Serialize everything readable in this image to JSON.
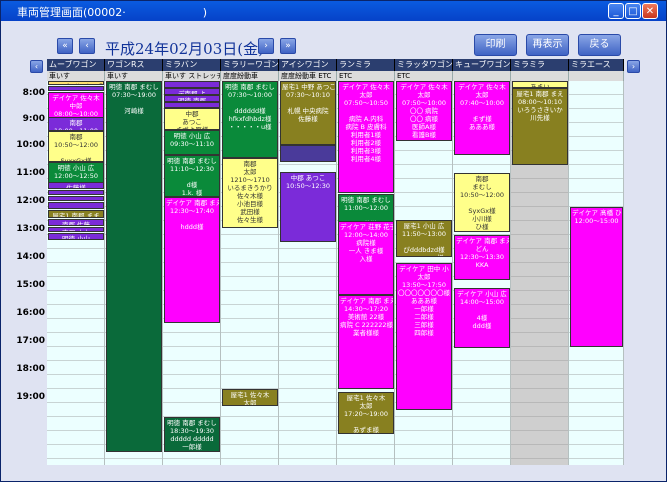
{
  "window": {
    "title": "車両管理画面(00002·                      )"
  },
  "nav": {
    "first": "«",
    "prev": "‹",
    "next": "›",
    "last": "»"
  },
  "date_label": "平成24年02月03日(金)",
  "actions": {
    "print": "印刷",
    "refresh": "再表示",
    "back": "戻る"
  },
  "columns": [
    {
      "name": "ムーブワゴン",
      "sub": "車いす"
    },
    {
      "name": "ワゴンRス",
      "sub": "車いす"
    },
    {
      "name": "ミラバン",
      "sub": "車いす ストレッチ"
    },
    {
      "name": "ミラリーワゴン",
      "sub": "度度紛動車"
    },
    {
      "name": "アイシワゴン",
      "sub": "度度紛動車 ETC"
    },
    {
      "name": "ランミラ",
      "sub": "ETC"
    },
    {
      "name": "ミラッタワゴン",
      "sub": "ETC"
    },
    {
      "name": "キューブワゴン",
      "sub": ""
    },
    {
      "name": "ミラミラ",
      "sub": ""
    },
    {
      "name": "ミラエース",
      "sub": ""
    }
  ],
  "times": [
    "8:00",
    "9:00",
    "10:00",
    "11:00",
    "12:00",
    "13:00",
    "14:00",
    "15:00",
    "16:00",
    "17:00",
    "18:00",
    "19:00"
  ],
  "bookings": [
    {
      "col": 0,
      "row": 0,
      "span": 0.3,
      "color": "#ffe070",
      "text": "ムーブ・瀬(中・〇〇"
    },
    {
      "col": 0,
      "row": 0.35,
      "span": 0.35,
      "color": "#7b2bd9",
      "text": ""
    },
    {
      "col": 0,
      "row": 0.75,
      "span": 2.6,
      "color": "#ff00ff",
      "text": "デイケア 佐々木\n中郎\n08:00〜10:00\nまず香様"
    },
    {
      "col": 0,
      "row": 2.6,
      "span": 1.0,
      "color": "#7b2bd9",
      "text": "南郡\n10:00〜11:00"
    },
    {
      "col": 0,
      "row": 3.6,
      "span": 2.2,
      "color": "#ffff8a",
      "text": "南郡\n10:50〜12:00\n\nSyxxGx様\n小川様\nひふVhn様"
    },
    {
      "col": 0,
      "row": 5.8,
      "span": 1.5,
      "color": "#0a8a3a",
      "text": "明徳 小山 広\n12:00〜12:50"
    },
    {
      "col": 0,
      "row": 7.2,
      "span": 0.5,
      "color": "#7b2bd9",
      "text": "佐藤様"
    },
    {
      "col": 0,
      "row": 7.75,
      "span": 0.4,
      "color": "#7b2bd9",
      "text": ""
    },
    {
      "col": 0,
      "row": 8.2,
      "span": 0.4,
      "color": "#7b2bd9",
      "text": ""
    },
    {
      "col": 0,
      "row": 8.65,
      "span": 0.5,
      "color": "#7b2bd9",
      "text": ""
    },
    {
      "col": 0,
      "row": 9.2,
      "span": 0.6,
      "color": "#888020",
      "text": "屋宅1 南郡 まま"
    },
    {
      "col": 0,
      "row": 9.85,
      "span": 0.5,
      "color": "#7b2bd9",
      "text": "南郡 佐藤"
    },
    {
      "col": 0,
      "row": 10.4,
      "span": 0.4,
      "color": "#7b2bd9",
      "text": "南郡 小山"
    },
    {
      "col": 0,
      "row": 10.85,
      "span": 0.5,
      "color": "#7b2bd9",
      "text": "明徳 小山"
    },
    {
      "col": 1,
      "row": 0,
      "span": 26.5,
      "color": "#0a6a3a",
      "text": "明徳 南郡 まむし\n07:30〜19:00\n\n河崎様"
    },
    {
      "col": 2,
      "row": 0,
      "span": 0.5,
      "color": "#7b2bd9",
      "text": ""
    },
    {
      "col": 2,
      "row": 0.5,
      "span": 0.5,
      "color": "#7b2bd9",
      "text": "デ南郡 よ"
    },
    {
      "col": 2,
      "row": 1.0,
      "span": 0.5,
      "color": "#7b2bd9",
      "text": "明徳 南郡"
    },
    {
      "col": 2,
      "row": 1.5,
      "span": 0.4,
      "color": "#7b2bd9",
      "text": ""
    },
    {
      "col": 2,
      "row": 1.9,
      "span": 1.6,
      "color": "#ffff8a",
      "text": "中郡\nあつこ\nまずよ原様"
    },
    {
      "col": 2,
      "row": 3.5,
      "span": 1.8,
      "color": "#0a8a3a",
      "text": "明徳 小山 広\n09:30〜11:10\n\nddddd様"
    },
    {
      "col": 2,
      "row": 5.3,
      "span": 3.0,
      "color": "#0a8a3a",
      "text": "明徳 南郡 まむし\n11:10〜12:30\n\nd様\n1.k. 様\nz様 様"
    },
    {
      "col": 2,
      "row": 8.3,
      "span": 9.0,
      "color": "#ff00ff",
      "text": "デイケア 南郡 まえ\n12:30〜17:40\n\nhddd様"
    },
    {
      "col": 2,
      "row": 24.0,
      "span": 2.5,
      "color": "#0a6a3a",
      "text": "明徳 南郡 まむし\n18:30〜19:30\nddddd ddddd\n一郎様"
    },
    {
      "col": 3,
      "row": 0,
      "span": 5.5,
      "color": "#0a8a3a",
      "text": "明徳 南郡 まむし\n07:30〜10:00\n\ndddddd様\nhfkxfdhbdz様\n・・・・・u様"
    },
    {
      "col": 3,
      "row": 5.5,
      "span": 5.0,
      "color": "#ffff8a",
      "text": "南郡\n太郎\n1210〜1710\nいるまきうかり\n佐々木様\n小池目様\n武田様\n佐々生様"
    },
    {
      "col": 3,
      "row": 22.0,
      "span": 1.2,
      "color": "#888020",
      "text": "屋宅1 佐々木\n太郎"
    },
    {
      "col": 4,
      "row": 0,
      "span": 4.6,
      "color": "#888020",
      "text": "屋宅1 中野 あつこ\n07:30〜10:10\n\n札幌 中央病院\n佐藤様"
    },
    {
      "col": 4,
      "row": 4.6,
      "span": 1.2,
      "color": "#4a3a9a",
      "text": ""
    },
    {
      "col": 4,
      "row": 6.5,
      "span": 5.0,
      "color": "#7b2bd9",
      "text": "中郡 あつこ\n10:50〜12:30"
    },
    {
      "col": 5,
      "row": 0,
      "span": 8.0,
      "color": "#ff00ff",
      "text": "デイケア 佐々木\n太郎\n07:50〜10:50\n\n病院 A.内科\n病院 B 皮膚科\n利用者1様\n利用者2様\n利用者3様\n利用者4様"
    },
    {
      "col": 5,
      "row": 8.1,
      "span": 2.0,
      "color": "#0a8a3a",
      "text": "明徳 南郡 まむし\n11:00〜12:00\n\nf阿蔵様"
    },
    {
      "col": 5,
      "row": 10.0,
      "span": 5.3,
      "color": "#ff00ff",
      "text": "デイケア 荘野 花子\n12:00〜14:00\n病院様\n一人 きま様\n入様"
    },
    {
      "col": 5,
      "row": 15.3,
      "span": 6.7,
      "color": "#ff00ff",
      "text": "デイケア 南郡 まえ\n14:30〜17:20\n美術館 22様\n病院 C 222222様\n業者様様"
    },
    {
      "col": 5,
      "row": 22.2,
      "span": 3.0,
      "color": "#888020",
      "text": "屋宅1 佐々木\n太郎\n17:20〜19:00\n\nあずま様"
    },
    {
      "col": 6,
      "row": 0,
      "span": 4.3,
      "color": "#ff00ff",
      "text": "デイケア 佐々木\n太郎\n07:50〜10:00\n〇〇 病院\n〇〇 病様\n医師A様\n看護B様"
    },
    {
      "col": 6,
      "row": 9.9,
      "span": 2.7,
      "color": "#888020",
      "text": "屋宅1 小山 広\n11:50〜13:00\n\nぴdddbdzd様\n・・・・・様"
    },
    {
      "col": 6,
      "row": 13.0,
      "span": 10.5,
      "color": "#ff00ff",
      "text": "デイケア 田中 小\n太郎\n13:50〜17:50\n〇〇〇〇〇〇〇様\nあああ様\n一郎様\n二郎様\n三郎様\n四郎様"
    },
    {
      "col": 7,
      "row": 0,
      "span": 5.3,
      "color": "#ff00ff",
      "text": "デイケア 佐々木\n太郎\n07:40〜10:00\n\nまず様\nあああ様"
    },
    {
      "col": 7,
      "row": 6.6,
      "span": 4.2,
      "color": "#ffff8a",
      "text": "南郡\nまむし\n10:50〜12:00\n\nSyxGx様\n小川様\nひ様"
    },
    {
      "col": 7,
      "row": 11.0,
      "span": 3.2,
      "color": "#ff00ff",
      "text": "デイケア 南郡 まえ\nどん\n12:30〜13:30\nKKA"
    },
    {
      "col": 7,
      "row": 14.8,
      "span": 4.3,
      "color": "#ff00ff",
      "text": "デイケア 小山 広\n14:00〜15:00\n\n4様\nddd様"
    },
    {
      "col": 8,
      "row": 0,
      "span": 0.5,
      "color": "#ffff8a",
      "text": "あまい"
    },
    {
      "col": 8,
      "row": 0.5,
      "span": 5.5,
      "color": "#888020",
      "text": "屋宅1 南郡 まえ\n08:00〜10:10\nいろうさきいか\n川先様"
    },
    {
      "col": 9,
      "row": 9.0,
      "span": 10.0,
      "color": "#ff00ff",
      "text": "デイケア 髙橋 ひ\n12:00〜15:00"
    }
  ]
}
